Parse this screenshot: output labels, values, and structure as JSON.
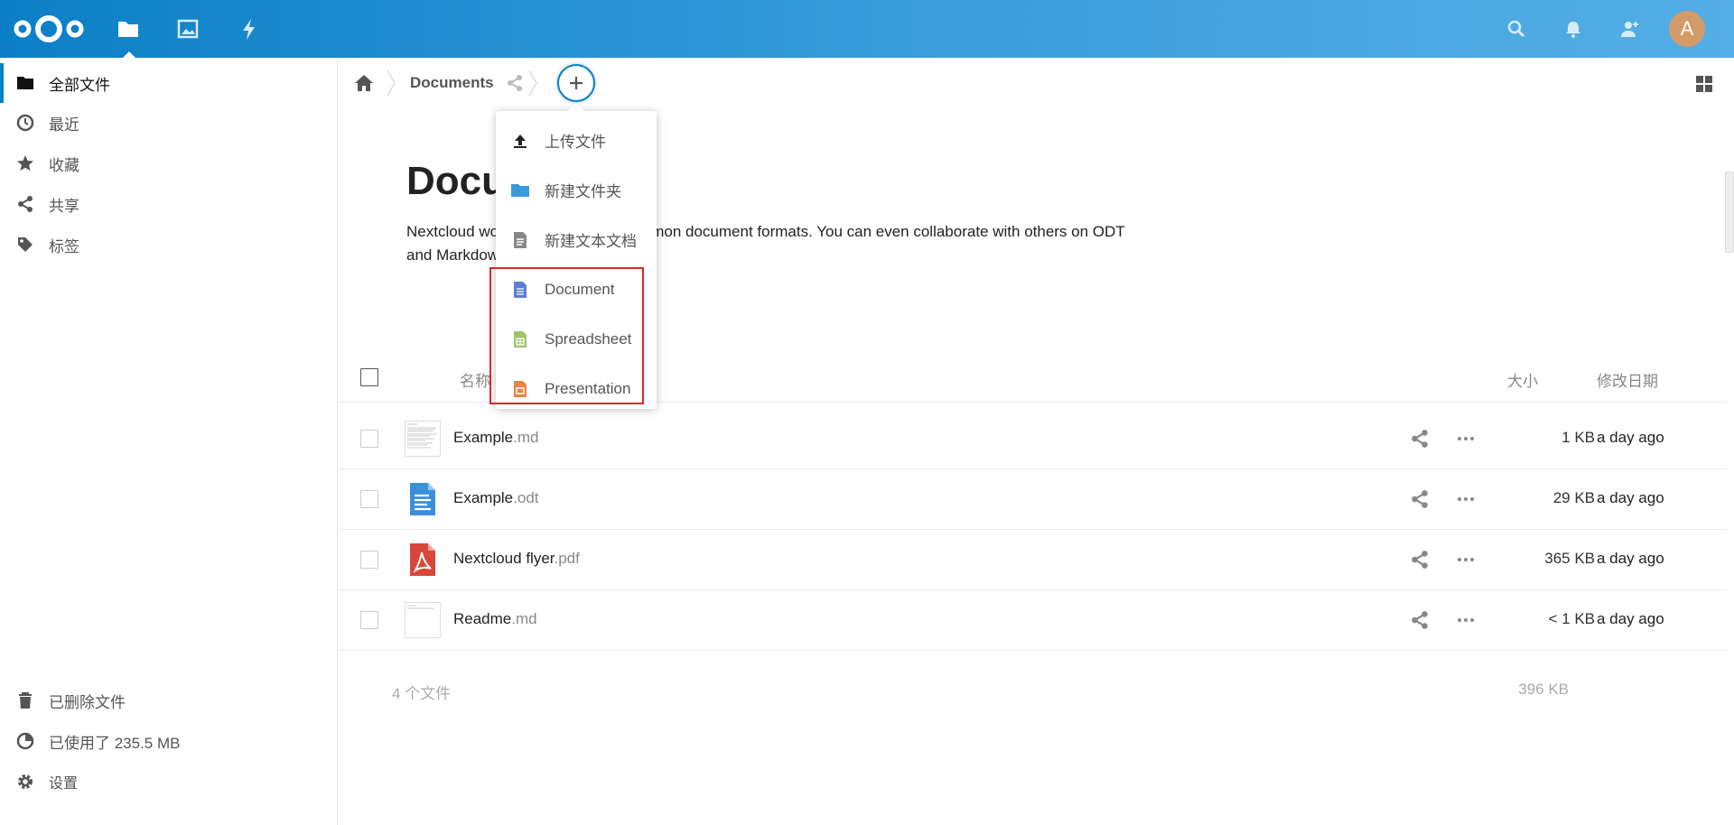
{
  "header": {
    "apps": [
      "files",
      "photos",
      "activity"
    ],
    "accent_color": "#0082c9",
    "avatar_letter": "A"
  },
  "sidebar": {
    "items": [
      {
        "label": "全部文件",
        "icon": "folder-icon"
      },
      {
        "label": "最近",
        "icon": "clock-icon"
      },
      {
        "label": "收藏",
        "icon": "star-icon"
      },
      {
        "label": "共享",
        "icon": "share-icon"
      },
      {
        "label": "标签",
        "icon": "tag-icon"
      }
    ],
    "bottom": [
      {
        "label": "已删除文件",
        "icon": "trash-icon"
      },
      {
        "label": "已使用了 235.5 MB",
        "icon": "pie-icon"
      },
      {
        "label": "设置",
        "icon": "gear-icon"
      }
    ]
  },
  "breadcrumb": {
    "current": "Documents"
  },
  "content": {
    "title": "Docu",
    "description_line1_start": "Nextcloud wo",
    "description_line1_end": "mmon document formats. You can even collaborate with others on ODT",
    "description_line2": "and Markdow"
  },
  "file_list": {
    "header_name": "名称",
    "header_size": "大小",
    "header_date": "修改日期",
    "files": [
      {
        "base": "Example",
        "ext": ".md",
        "size": "1 KB",
        "date": "a day ago",
        "thumb": "md-thumb"
      },
      {
        "base": "Example",
        "ext": ".odt",
        "size": "29 KB",
        "date": "a day ago",
        "thumb": "odt-icon"
      },
      {
        "base": "Nextcloud flyer",
        "ext": ".pdf",
        "size": "365 KB",
        "date": "a day ago",
        "thumb": "pdf-icon"
      },
      {
        "base": "Readme",
        "ext": ".md",
        "size": "< 1 KB",
        "date": "a day ago",
        "thumb": "md-thumb"
      }
    ],
    "summary_count": "4 个文件",
    "summary_size": "396 KB"
  },
  "new_menu": {
    "items": [
      {
        "label": "上传文件",
        "icon": "upload-icon"
      },
      {
        "label": "新建文件夹",
        "icon": "folder-icon"
      },
      {
        "label": "新建文本文档",
        "icon": "text-file-icon"
      },
      {
        "label": "Document",
        "icon": "document-icon"
      },
      {
        "label": "Spreadsheet",
        "icon": "spreadsheet-icon"
      },
      {
        "label": "Presentation",
        "icon": "presentation-icon"
      }
    ]
  }
}
